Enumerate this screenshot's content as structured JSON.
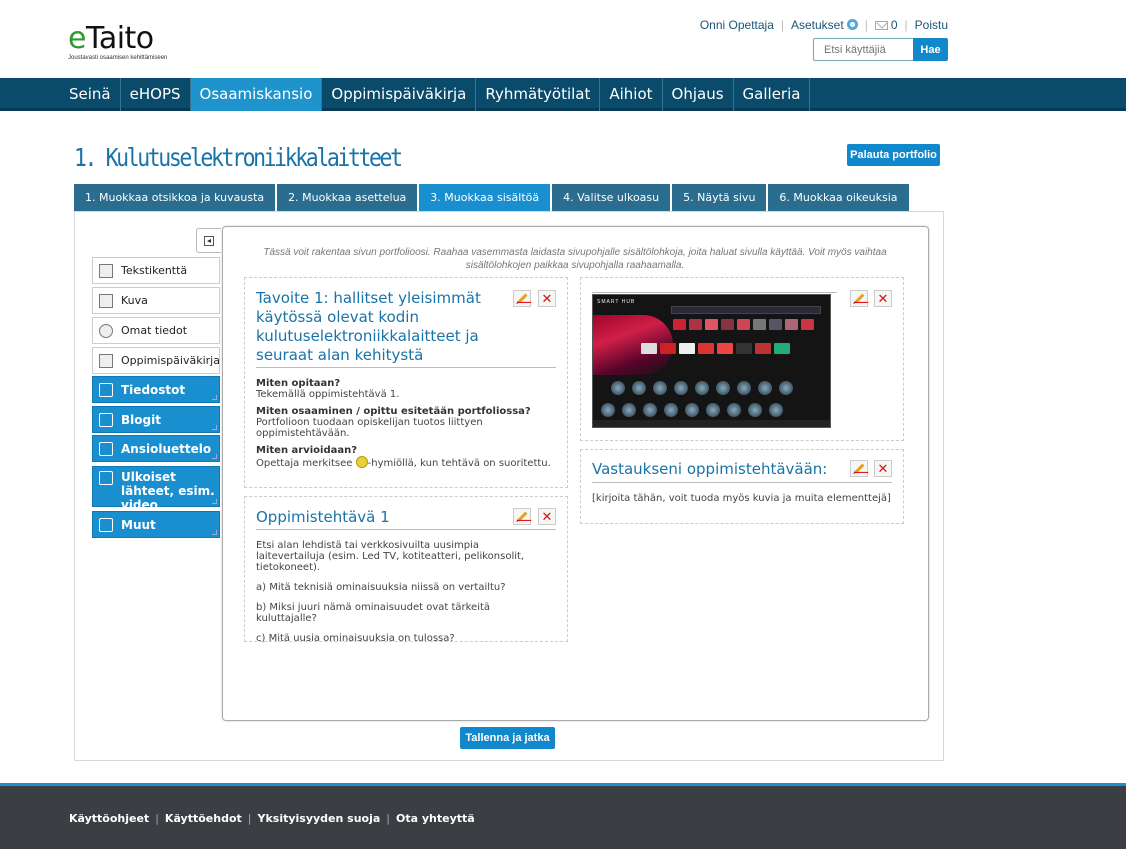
{
  "brand": {
    "name_e": "e",
    "name_rest": "Taito",
    "tagline": "Joustavasti osaamisen kehittämiseen"
  },
  "topbar": {
    "user": "Onni Opettaja",
    "settings": "Asetukset",
    "mail_count": "0",
    "logout": "Poistu",
    "search_placeholder": "Etsi käyttäjiä",
    "search_button": "Hae"
  },
  "nav": [
    "Seinä",
    "eHOPS",
    "Osaamiskansio",
    "Oppimispäiväkirja",
    "Ryhmätyötilat",
    "Aihiot",
    "Ohjaus",
    "Galleria"
  ],
  "page_title": "1. Kulutuselektroniikkalaitteet",
  "return_button": "Palauta portfolio",
  "tabs": [
    "1. Muokkaa otsikkoa ja kuvausta",
    "2. Muokkaa asettelua",
    "3. Muokkaa sisältöä",
    "4. Valitse ulkoasu",
    "5. Näytä sivu",
    "6. Muokkaa oikeuksia"
  ],
  "hint": "Tässä voit rakentaa sivun portfolioosi. Raahaa vasemmasta laidasta sivupohjalle sisältölohkoja, joita haluat sivulla käyttää. Voit myös vaihtaa sisältölohkojen paikkaa sivupohjalla raahaamalla.",
  "palette": {
    "white": [
      "Tekstikenttä",
      "Kuva",
      "Omat tiedot",
      "Oppimispäiväkirja"
    ],
    "blue": [
      "Tiedostot",
      "Blogit",
      "Ansioluettelo",
      "Ulkoiset lähteet, esim. video",
      "Muut"
    ]
  },
  "block1": {
    "title": "Tavoite 1: hallitset yleisimmät käytössä olevat kodin kulutuselektroniikkalaitteet ja seuraat alan kehitystä",
    "q1": "Miten opitaan?",
    "a1": "Tekemällä oppimistehtävä 1.",
    "q2": "Miten osaaminen / opittu esitetään portfoliossa?",
    "a2": "Portfolioon tuodaan opiskelijan tuotos liittyen oppimistehtävään.",
    "q3": "Miten arvioidaan?",
    "a3_pre": "Opettaja merkitsee ",
    "a3_post": "-hymiöllä, kun tehtävä on suoritettu."
  },
  "block2": {
    "title": "Oppimistehtävä 1",
    "intro": "Etsi alan lehdistä tai verkkosivuilta uusimpia laitevertailuja (esim. Led TV, kotiteatteri, pelikonsolit, tietokoneet).",
    "qa": "a) Mitä teknisiä ominaisuuksia niissä on vertailtu?",
    "qb": "b) Miksi juuri nämä ominaisuudet ovat tärkeitä kuluttajalle?",
    "qc": "c) Mitä uusia ominaisuuksia on tulossa?"
  },
  "image_block": {
    "hub_label": "SMART HUB"
  },
  "block3": {
    "title": "Vastaukseni oppimistehtävään:",
    "body": "[kirjoita tähän, voit tuoda myös kuvia ja muita elementtejä]"
  },
  "close_glyph": "✕",
  "save_button": "Tallenna ja jatka",
  "footer": [
    "Käyttöohjeet",
    "Käyttöehdot",
    "Yksityisyyden suoja",
    "Ota yhteyttä"
  ]
}
